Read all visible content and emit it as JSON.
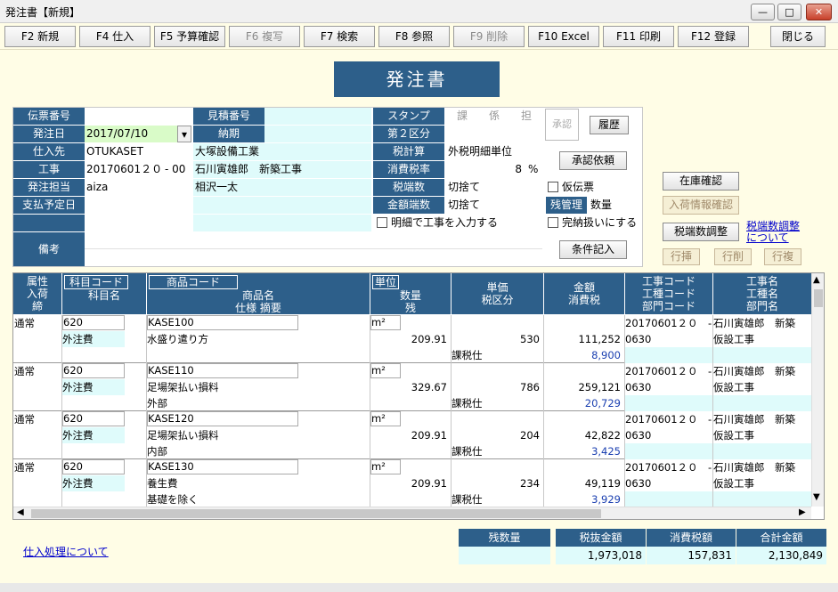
{
  "window": {
    "title": "発注書【新規】"
  },
  "toolbar": {
    "f2": "F2 新規",
    "f4": "F4 仕入",
    "f5": "F5 予算確認",
    "f6": "F6 複写",
    "f7": "F7 検索",
    "f8": "F8 参照",
    "f9": "F9 削除",
    "f10": "F10 Excel",
    "f11": "F11 印刷",
    "f12": "F12 登録",
    "close": "閉じる"
  },
  "form": {
    "title": "発注書",
    "labels": {
      "denpyo": "伝票番号",
      "mitsumori": "見積番号",
      "stamp": "スタンプ",
      "hachubi": "発注日",
      "noki": "納期",
      "kubun2": "第２区分",
      "shiiresaki": "仕入先",
      "zeikeisan": "税計算",
      "koji": "工事",
      "shohizeiritsu": "消費税率",
      "tanto": "発注担当",
      "zeihasu": "税端数",
      "shiharai": "支払予定日",
      "kingakuhasu": "金額端数",
      "zankanri": "残管理",
      "biko": "備考"
    },
    "stamp_cells": [
      "課",
      "係",
      "担"
    ],
    "values": {
      "hachubi": "2017/07/10",
      "shiiresaki_code": "OTUKASET",
      "shiiresaki_name": "大塚設備工業",
      "koji_code": "20170601２０",
      "koji_sub": "- 00",
      "koji_name": "石川寅雄郎　新築工事",
      "tanto_code": "aiza",
      "tanto_name": "相沢一太",
      "zeikeisan": "外税明細単位",
      "shohizeiritsu": "8",
      "percent": "%",
      "zeihasu": "切捨て",
      "kingakuhasu": "切捨て",
      "zankanri": "数量"
    },
    "checks": {
      "meisai_koji": "明細で工事を入力する",
      "kari": "仮伝票",
      "kanno": "完納扱いにする"
    },
    "stamp_approve": "承認",
    "buttons": {
      "rireki": "履歴",
      "shonin": "承認依頼",
      "joken": "条件記入",
      "zaiko": "在庫確認",
      "nyuka": "入荷情報確認",
      "zeihasu_adj": "税端数調整",
      "row_insert": "行挿",
      "row_delete": "行削",
      "row_copy": "行複"
    },
    "link_zeihasu": "税端数調整について"
  },
  "grid": {
    "headers": {
      "zokusei": "属性",
      "nyuka": "入荷",
      "shime": "締",
      "kamoku_code": "科目コード",
      "kamoku_name": "科目名",
      "shohin_code": "商品コード",
      "shohin_name": "商品名",
      "shiyo": "仕様 摘要",
      "tani": "単位",
      "suryo": "数量",
      "zan": "残",
      "tanka": "単価",
      "zeikubun": "税区分",
      "kingaku": "金額",
      "shohizei": "消費税",
      "koji_code": "工事コード",
      "koji_code2": "工種コード",
      "bumon_code": "部門コード",
      "koji_name": "工事名",
      "koshu_name": "工種名",
      "bumon_name": "部門名"
    },
    "rows": [
      {
        "zokusei": "通常",
        "kamoku_code": "620",
        "kamoku_name": "外注費",
        "shohin_code": "KASE100",
        "shohin_name": "水盛り遣り方",
        "shiyo": "",
        "tani": "m²",
        "suryo": "209.91",
        "tanka": "530",
        "zeikubun": "課税仕",
        "kingaku": "111,252",
        "shohizei": "8,900",
        "koji_code": "20170601２０　- 00",
        "koshu_code": "0630",
        "koji_name": "石川寅雄郎　新築",
        "koshu_name": "仮設工事"
      },
      {
        "zokusei": "通常",
        "kamoku_code": "620",
        "kamoku_name": "外注費",
        "shohin_code": "KASE110",
        "shohin_name": "足場架払い損料",
        "shiyo": "外部",
        "tani": "m²",
        "suryo": "329.67",
        "tanka": "786",
        "zeikubun": "課税仕",
        "kingaku": "259,121",
        "shohizei": "20,729",
        "koji_code": "20170601２０　- 00",
        "koshu_code": "0630",
        "koji_name": "石川寅雄郎　新築",
        "koshu_name": "仮設工事"
      },
      {
        "zokusei": "通常",
        "kamoku_code": "620",
        "kamoku_name": "外注費",
        "shohin_code": "KASE120",
        "shohin_name": "足場架払い損料",
        "shiyo": "内部",
        "tani": "m²",
        "suryo": "209.91",
        "tanka": "204",
        "zeikubun": "課税仕",
        "kingaku": "42,822",
        "shohizei": "3,425",
        "koji_code": "20170601２０　- 00",
        "koshu_code": "0630",
        "koji_name": "石川寅雄郎　新築",
        "koshu_name": "仮設工事"
      },
      {
        "zokusei": "通常",
        "kamoku_code": "620",
        "kamoku_name": "外注費",
        "shohin_code": "KASE130",
        "shohin_name": "養生費",
        "shiyo": "基礎を除く",
        "tani": "m²",
        "suryo": "209.91",
        "tanka": "234",
        "zeikubun": "課税仕",
        "kingaku": "49,119",
        "shohizei": "3,929",
        "koji_code": "20170601２０　- 00",
        "koshu_code": "0630",
        "koji_name": "石川寅雄郎　新築",
        "koshu_name": "仮設工事"
      }
    ]
  },
  "summary": {
    "zansuryo": "残数量",
    "zeinuki": "税抜金額",
    "shohizei": "消費税額",
    "gokei": "合計金額",
    "zeinuki_v": "1,973,018",
    "shohizei_v": "157,831",
    "gokei_v": "2,130,849"
  },
  "footer": {
    "link": "仕入処理について"
  }
}
